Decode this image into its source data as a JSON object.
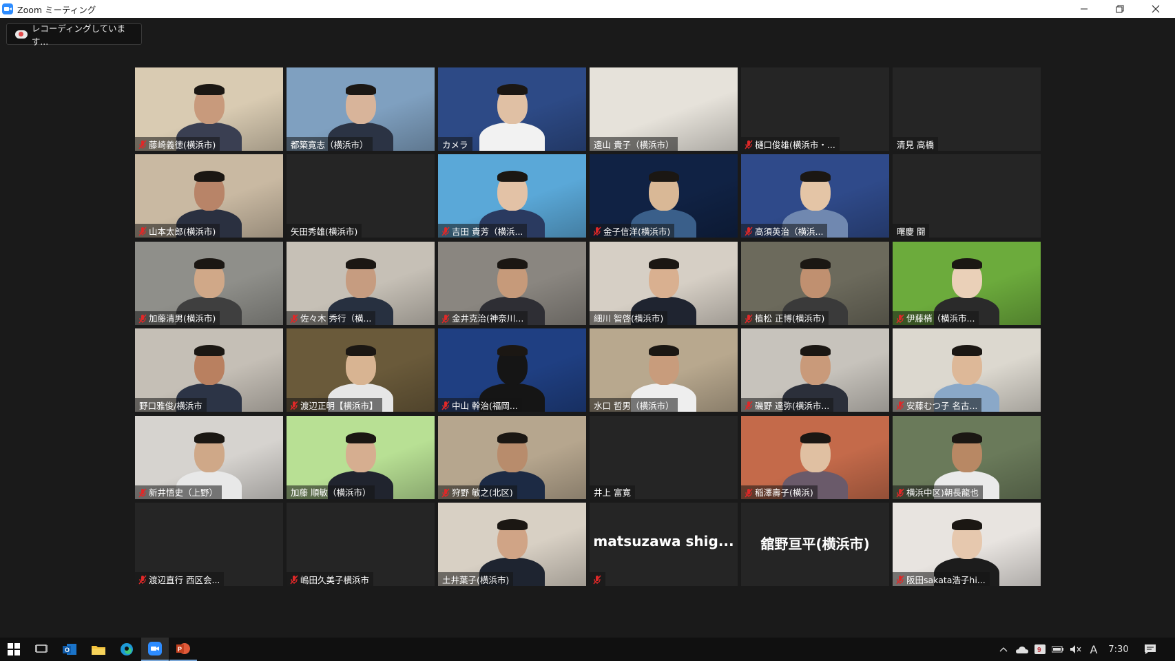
{
  "window": {
    "title": "Zoom ミーティング"
  },
  "recording": {
    "label": "レコーディングしています..."
  },
  "participants": [
    {
      "name": "藤崎義徳(横浜市)",
      "muted": true,
      "video": true,
      "bg": "#d9cbb2",
      "skin": "#c89a7c",
      "shirt": "#3a3f52"
    },
    {
      "name": "都築寛志（横浜市）",
      "muted": false,
      "video": true,
      "bg": "#7fa0c0",
      "skin": "#d8b49a",
      "shirt": "#2b3344"
    },
    {
      "name": "カメラ",
      "muted": false,
      "video": true,
      "bg": "#2d4a86",
      "skin": "#e0c0a4",
      "shirt": "#f2f2f2"
    },
    {
      "name": "遠山 貴子（横浜市）",
      "muted": false,
      "video": true,
      "bg": "#e6e2da",
      "skin": "#e6e2da",
      "shirt": "#e6e2da"
    },
    {
      "name": "樋口俊雄(横浜市・...",
      "muted": true,
      "video": false
    },
    {
      "name": "清見 高橋",
      "muted": false,
      "video": false
    },
    {
      "name": "山本太郎(横浜市)",
      "muted": true,
      "video": true,
      "bg": "#c9b9a2",
      "skin": "#b88468",
      "shirt": "#2a3040"
    },
    {
      "name": "矢田秀雄(横浜市)",
      "muted": false,
      "video": false
    },
    {
      "name": "吉田 貴芳（横浜...",
      "muted": true,
      "video": true,
      "bg": "#5aa8d8",
      "skin": "#e3c2a6",
      "shirt": "#2a3a60"
    },
    {
      "name": "金子信洋(横浜市)",
      "muted": true,
      "video": true,
      "bg": "#102244",
      "skin": "#d9b896",
      "shirt": "#3a5f8a"
    },
    {
      "name": "高須英治（横浜...",
      "muted": true,
      "video": true,
      "bg": "#2f4a8a",
      "skin": "#e4c5a6",
      "shirt": "#7088b0"
    },
    {
      "name": "曙慶 闘",
      "muted": false,
      "video": false
    },
    {
      "name": "加藤清男(横浜市)",
      "muted": true,
      "video": true,
      "bg": "#8f8f8a",
      "skin": "#d0a888",
      "shirt": "#3f3f3f"
    },
    {
      "name": "佐々木 秀行（横...",
      "muted": true,
      "video": true,
      "bg": "#c6c0b6",
      "skin": "#c69c80",
      "shirt": "#273040"
    },
    {
      "name": "金井克治(神奈川...",
      "muted": true,
      "video": true,
      "bg": "#8a8680",
      "skin": "#c69a7a",
      "shirt": "#2e2e34"
    },
    {
      "name": "細川 智啓(横浜市)",
      "muted": false,
      "video": true,
      "bg": "#d6cfc5",
      "skin": "#d9b090",
      "shirt": "#1f2430"
    },
    {
      "name": "植松 正博(横浜市)",
      "muted": true,
      "video": true,
      "bg": "#6c6a5c",
      "skin": "#c09070",
      "shirt": "#3a3a3a"
    },
    {
      "name": "伊藤梢（横浜市...",
      "muted": true,
      "video": true,
      "bg": "#6cab3c",
      "skin": "#ead0b8",
      "shirt": "#2a2a2a"
    },
    {
      "name": "野口雅俊/横浜市",
      "muted": false,
      "video": true,
      "bg": "#c5bfb6",
      "skin": "#b98060",
      "shirt": "#2c3446"
    },
    {
      "name": "渡辺正明【横浜市】",
      "muted": true,
      "video": true,
      "bg": "#6a5a3a",
      "skin": "#d8b492",
      "shirt": "#e6e6e6"
    },
    {
      "name": "中山 幹治(福岡...",
      "muted": true,
      "video": true,
      "bg": "#1f3f82",
      "skin": "#151515",
      "shirt": "#151515"
    },
    {
      "name": "水口 哲男（横浜市）",
      "muted": false,
      "video": true,
      "bg": "#b8a88e",
      "skin": "#c89c7c",
      "shirt": "#eeeeee"
    },
    {
      "name": "磯野 達弥(横浜市...",
      "muted": true,
      "video": true,
      "bg": "#c7c3bc",
      "skin": "#c99a7a",
      "shirt": "#2b2f3a"
    },
    {
      "name": "安藤むつ子 名古...",
      "muted": true,
      "video": true,
      "bg": "#dcd8cf",
      "skin": "#ddb898",
      "shirt": "#8aa8c8"
    },
    {
      "name": "新井悟史（上野）",
      "muted": true,
      "video": true,
      "bg": "#d6d3cf",
      "skin": "#cfa888",
      "shirt": "#e8e8e8"
    },
    {
      "name": "加藤 順敏（横浜市）",
      "muted": false,
      "video": true,
      "bg": "#b8e094",
      "skin": "#d6ae90",
      "shirt": "#20242e"
    },
    {
      "name": "狩野 敏之(北区)",
      "muted": true,
      "video": true,
      "bg": "#b6a68e",
      "skin": "#b88c6c",
      "shirt": "#1c2a44"
    },
    {
      "name": "井上 富寛",
      "muted": false,
      "video": false
    },
    {
      "name": "稲澤壽子(横浜)",
      "muted": true,
      "video": true,
      "bg": "#c46a4a",
      "skin": "#e0c0a2",
      "shirt": "#6a5a6a"
    },
    {
      "name": "横浜中区)朝長龍也",
      "muted": true,
      "video": true,
      "bg": "#6a7a5a",
      "skin": "#b88864",
      "shirt": "#eaeaea"
    },
    {
      "name": "渡辺直行 西区会...",
      "muted": true,
      "video": false
    },
    {
      "name": "嶋田久美子横浜市",
      "muted": true,
      "video": false
    },
    {
      "name": "土井葉子(横浜市)",
      "muted": false,
      "video": true,
      "bg": "#d8d0c4",
      "skin": "#d0a486",
      "shirt": "#1e2430"
    },
    {
      "name": "",
      "muted": true,
      "video": false,
      "big_name": "matsuzawa shig..."
    },
    {
      "name": "",
      "muted": false,
      "video": false,
      "big_name": "舘野亘平(横浜市)"
    },
    {
      "name": "阪田sakata浩子hi...",
      "muted": true,
      "video": true,
      "bg": "#e8e4e0",
      "skin": "#e6c8ae",
      "shirt": "#1c1c1c"
    }
  ],
  "taskbar": {
    "apps": [
      "start-icon",
      "task-view-icon",
      "outlook-icon",
      "file-explorer-icon",
      "edge-icon",
      "zoom-icon",
      "powerpoint-icon"
    ],
    "ime": "A",
    "time": "7:30"
  }
}
